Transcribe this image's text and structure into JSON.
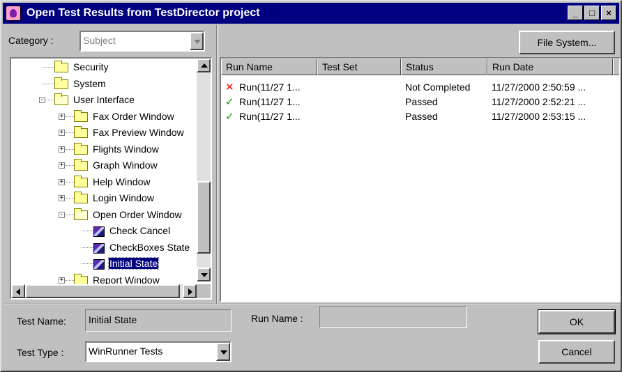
{
  "window": {
    "title": "Open Test Results from TestDirector project",
    "controls": {
      "minimize": "_",
      "maximize": "□",
      "close": "×"
    }
  },
  "category": {
    "label": "Category :",
    "value": "Subject"
  },
  "file_system_button": "File System...",
  "tree": {
    "nodes": [
      {
        "label": "Security",
        "type": "folder",
        "level": 1
      },
      {
        "label": "System",
        "type": "folder",
        "level": 1
      },
      {
        "label": "User Interface",
        "type": "folder-open",
        "level": 1,
        "expander": "-"
      },
      {
        "label": "Fax Order Window",
        "type": "folder",
        "level": 2,
        "expander": "+"
      },
      {
        "label": "Fax Preview Window",
        "type": "folder",
        "level": 2,
        "expander": "+"
      },
      {
        "label": "Flights Window",
        "type": "folder",
        "level": 2,
        "expander": "+"
      },
      {
        "label": "Graph Window",
        "type": "folder",
        "level": 2,
        "expander": "+"
      },
      {
        "label": "Help Window",
        "type": "folder",
        "level": 2,
        "expander": "+"
      },
      {
        "label": "Login Window",
        "type": "folder",
        "level": 2,
        "expander": "+"
      },
      {
        "label": "Open Order Window",
        "type": "folder-open",
        "level": 2,
        "expander": "-"
      },
      {
        "label": "Check Cancel",
        "type": "test",
        "level": 3
      },
      {
        "label": "CheckBoxes State",
        "type": "test",
        "level": 3
      },
      {
        "label": "Initial State",
        "type": "test",
        "level": 3,
        "selected": true
      },
      {
        "label": "Report Window",
        "type": "folder",
        "level": 2,
        "expander": "+"
      }
    ]
  },
  "results": {
    "columns": [
      "Run Name",
      "Test Set",
      "Status",
      "Run Date"
    ],
    "rows": [
      {
        "status_icon": "fail-x-icon",
        "mark": "✕",
        "run_name": "Run(11/27 1...",
        "test_set": "",
        "status": "Not Completed",
        "run_date": "11/27/2000 2:50:59 ..."
      },
      {
        "status_icon": "pass-check-icon",
        "mark": "✓",
        "run_name": "Run(11/27 1...",
        "test_set": "",
        "status": "Passed",
        "run_date": "11/27/2000 2:52:21 ..."
      },
      {
        "status_icon": "pass-check-icon",
        "mark": "✓",
        "run_name": "Run(11/27 1...",
        "test_set": "",
        "status": "Passed",
        "run_date": "11/27/2000 2:53:15 ..."
      }
    ]
  },
  "test_name": {
    "label": "Test Name:",
    "value": "Initial State"
  },
  "run_name": {
    "label": "Run Name :",
    "value": ""
  },
  "test_type": {
    "label": "Test Type :",
    "value": "WinRunner Tests"
  },
  "buttons": {
    "ok": "OK",
    "cancel": "Cancel"
  },
  "colors": {
    "titlebar": "#000080",
    "face": "#c0c0c0",
    "selection": "#000080",
    "fail": "#ff0000",
    "pass": "#00a000"
  }
}
